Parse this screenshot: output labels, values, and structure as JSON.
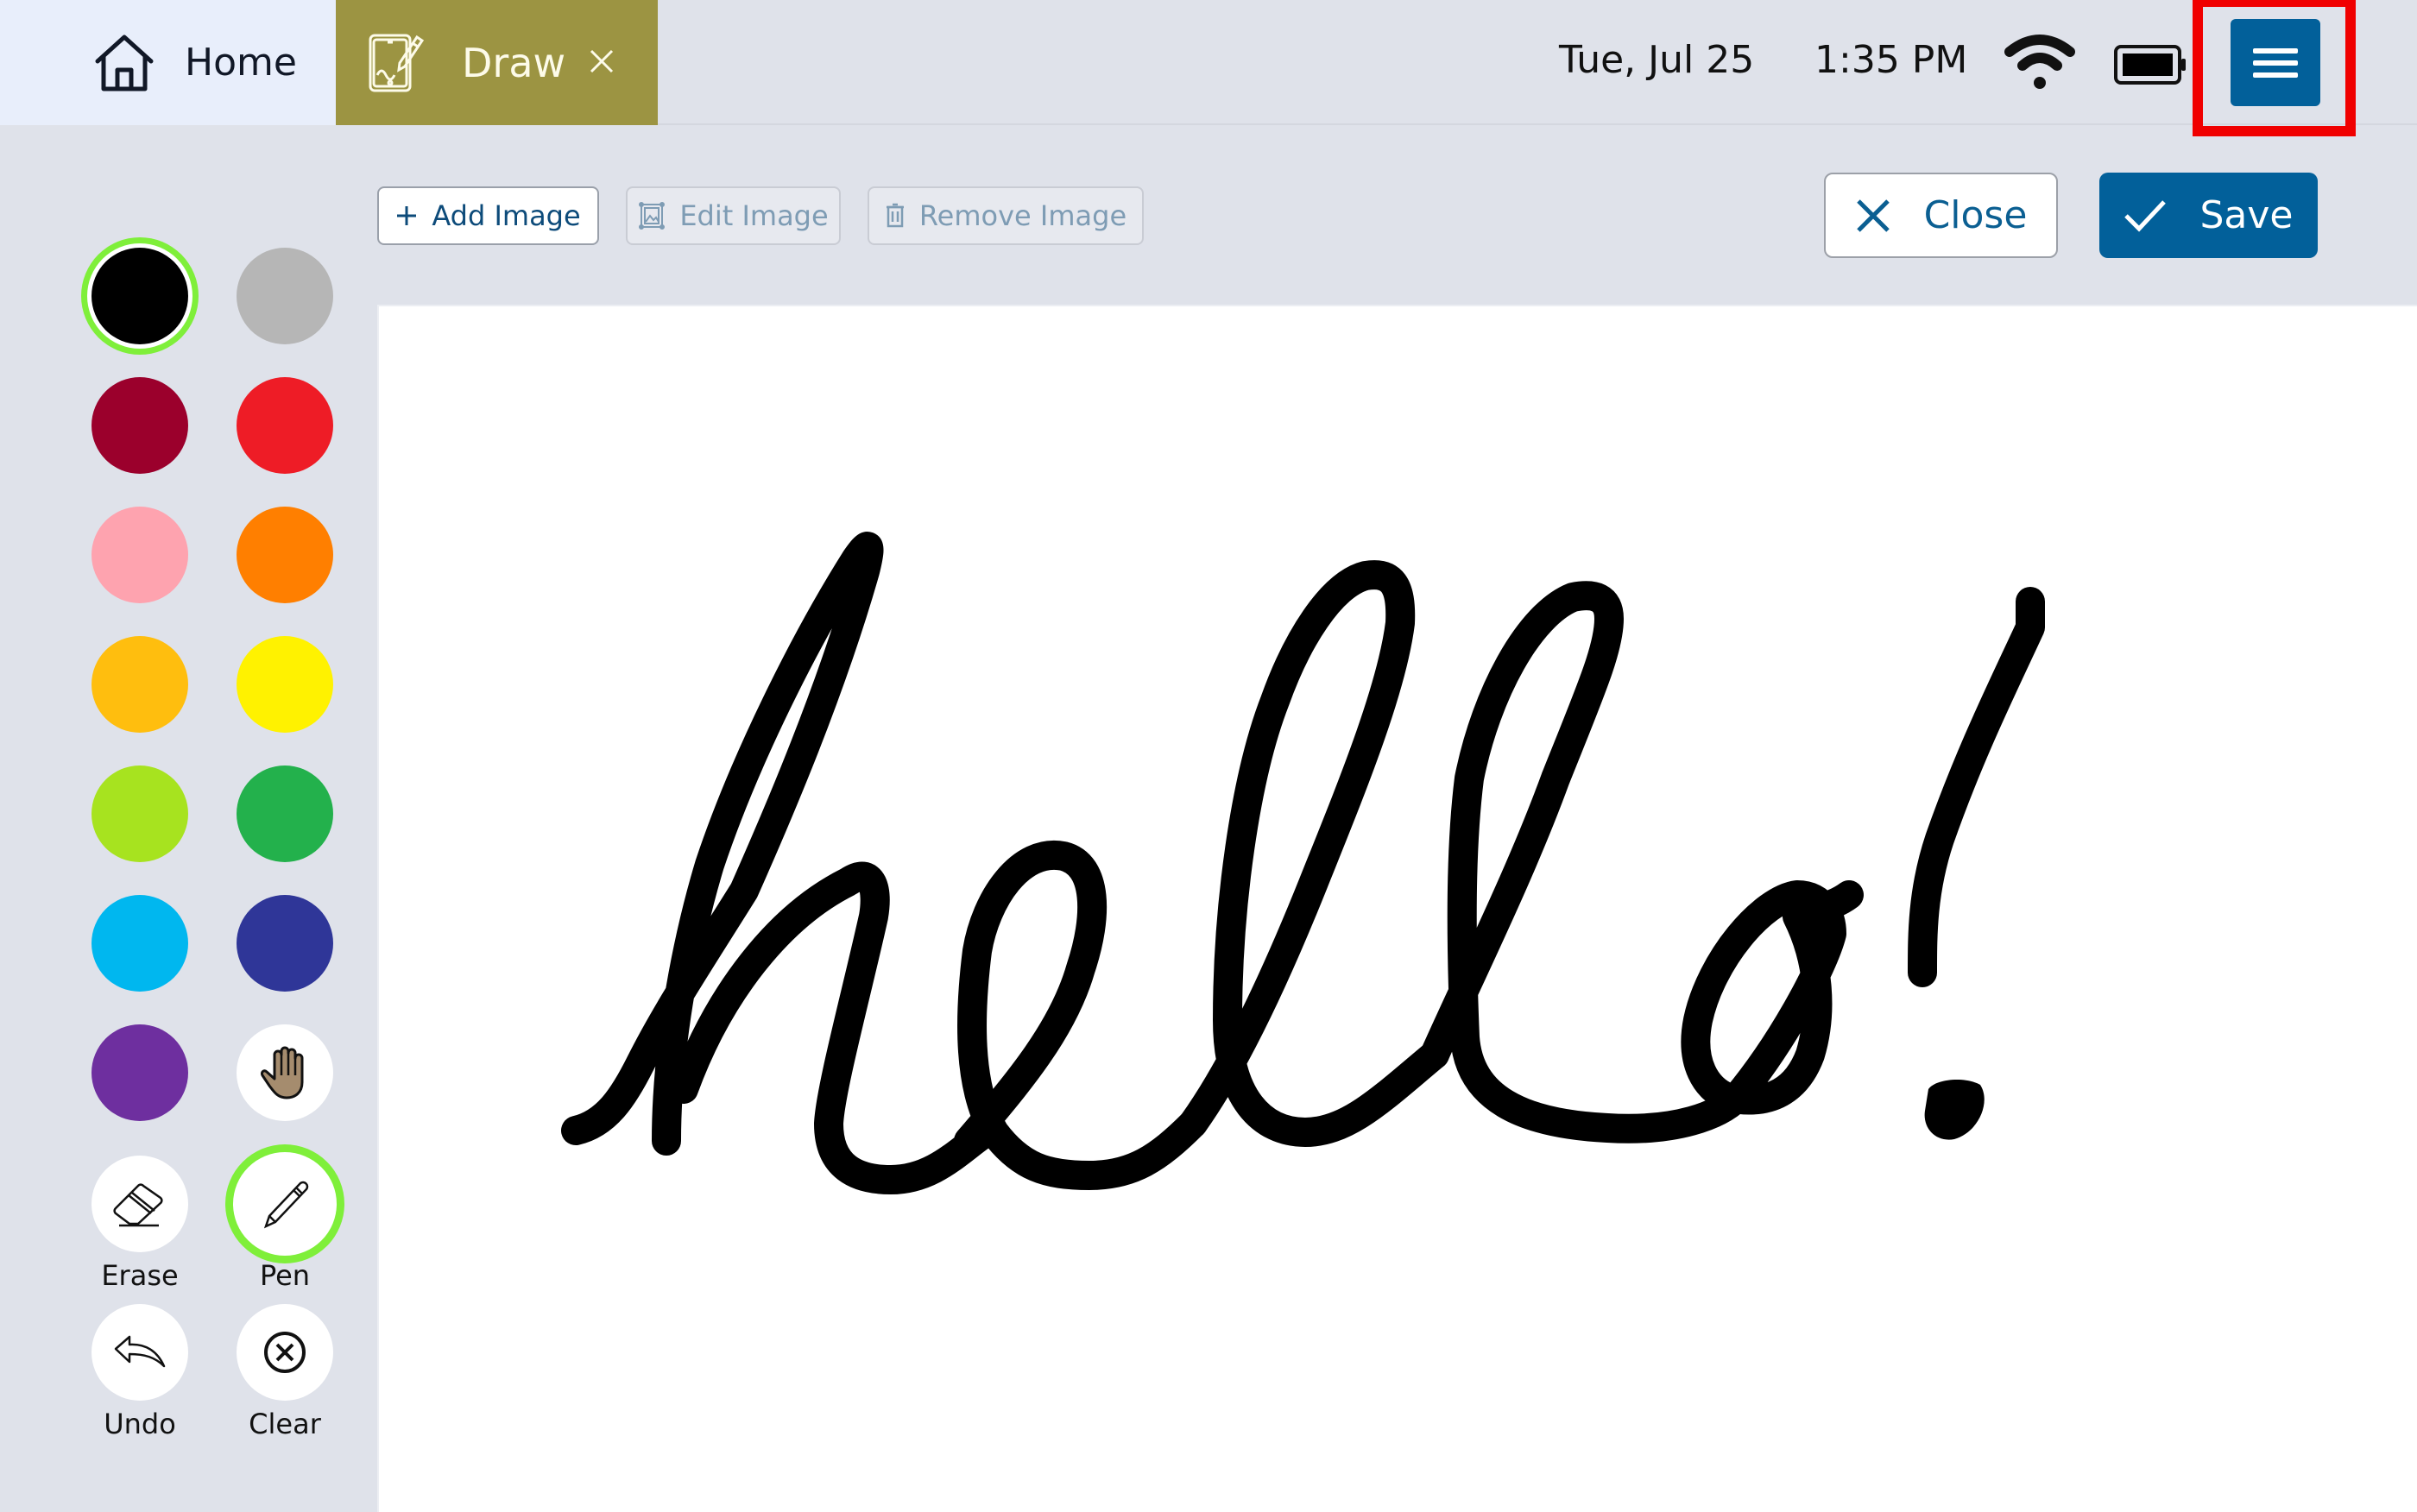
{
  "topbar": {
    "tabs": [
      {
        "label": "Home",
        "icon": "home-icon",
        "active": false
      },
      {
        "label": "Draw",
        "icon": "drawing-tablet-icon",
        "active": true,
        "closable": true,
        "color": "#9c9442"
      }
    ],
    "date": "Tue, Jul 25",
    "time": "1:35 PM",
    "wifi": "wifi-icon",
    "battery": "battery-full-icon",
    "menu_icon": "hamburger-menu-icon",
    "menu_highlighted": true
  },
  "toolbar": {
    "add_image": {
      "label": "Add Image",
      "icon": "plus-icon",
      "enabled": true
    },
    "edit_image": {
      "label": "Edit Image",
      "icon": "edit-image-icon",
      "enabled": false
    },
    "remove_image": {
      "label": "Remove Image",
      "icon": "trash-icon",
      "enabled": false
    },
    "close": {
      "label": "Close",
      "icon": "close-icon"
    },
    "save": {
      "label": "Save",
      "icon": "check-icon"
    }
  },
  "palette": {
    "selected_color": "#000000",
    "colors": [
      {
        "name": "black",
        "hex": "#000000"
      },
      {
        "name": "gray",
        "hex": "#b6b6b6"
      },
      {
        "name": "dark-red",
        "hex": "#9b002c"
      },
      {
        "name": "red",
        "hex": "#ee1c26"
      },
      {
        "name": "pink",
        "hex": "#fea3af"
      },
      {
        "name": "orange",
        "hex": "#ff7f00"
      },
      {
        "name": "amber",
        "hex": "#ffbe0e"
      },
      {
        "name": "yellow",
        "hex": "#fff200"
      },
      {
        "name": "lime",
        "hex": "#a7e31f"
      },
      {
        "name": "green",
        "hex": "#23b14c"
      },
      {
        "name": "sky-blue",
        "hex": "#00b7ef"
      },
      {
        "name": "indigo",
        "hex": "#2f3698"
      },
      {
        "name": "purple",
        "hex": "#6e2f9f"
      }
    ]
  },
  "tools": {
    "pan": {
      "icon": "hand-icon"
    },
    "erase": {
      "label": "Erase",
      "icon": "eraser-icon"
    },
    "pen": {
      "label": "Pen",
      "icon": "pencil-icon",
      "selected": true
    },
    "undo": {
      "label": "Undo",
      "icon": "undo-arrow-icon"
    },
    "clear": {
      "label": "Clear",
      "icon": "clear-circle-x-icon"
    }
  },
  "canvas": {
    "drawing_text": "hello!",
    "stroke_color": "#000000"
  },
  "colors": {
    "primary": "#02609a",
    "highlight": "#f00000",
    "selection_ring": "#7fef3a",
    "background": "#dfe2ea"
  }
}
